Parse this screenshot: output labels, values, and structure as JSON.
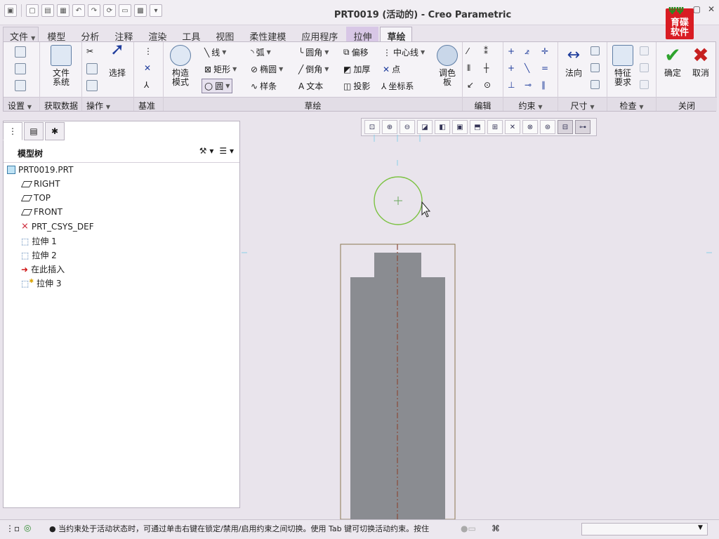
{
  "window": {
    "title": "PRT0019 (活动的) - Creo Parametric",
    "logo_text": "育碟软件"
  },
  "tabs": [
    "文件",
    "模型",
    "分析",
    "注释",
    "渲染",
    "工具",
    "视图",
    "柔性建模",
    "应用程序",
    "拉伸",
    "草绘"
  ],
  "ribbon": {
    "groups": [
      "设置",
      "获取数据",
      "操作",
      "基准",
      "草绘",
      "编辑",
      "约束",
      "尺寸",
      "检查",
      "关闭"
    ],
    "file_system": "文件\n系统",
    "select": "选择",
    "construct_mode": "构造\n模式",
    "sketch": {
      "line": "线",
      "arc": "弧",
      "fillet": "圆角",
      "offset": "偏移",
      "centerline": "中心线",
      "rect": "矩形",
      "ellipse": "椭圆",
      "chamfer": "倒角",
      "thicken": "加厚",
      "point": "点",
      "circle": "圆",
      "spline": "样条",
      "text": "文本",
      "project": "投影",
      "csys": "坐标系",
      "palette": "调色\n板"
    },
    "normal": "法向",
    "feature_req": "特征\n要求",
    "ok": "确定",
    "cancel": "取消"
  },
  "model_tree": {
    "title": "模型树",
    "items": [
      "PRT0019.PRT",
      "RIGHT",
      "TOP",
      "FRONT",
      "PRT_CSYS_DEF",
      "拉伸 1",
      "拉伸 2",
      "在此插入",
      "拉伸 3"
    ]
  },
  "status": {
    "message": "● 当约束处于活动状态时，可通过单击右键在锁定/禁用/启用约束之间切换。使用 Tab 键可切换活动约束。按住"
  }
}
